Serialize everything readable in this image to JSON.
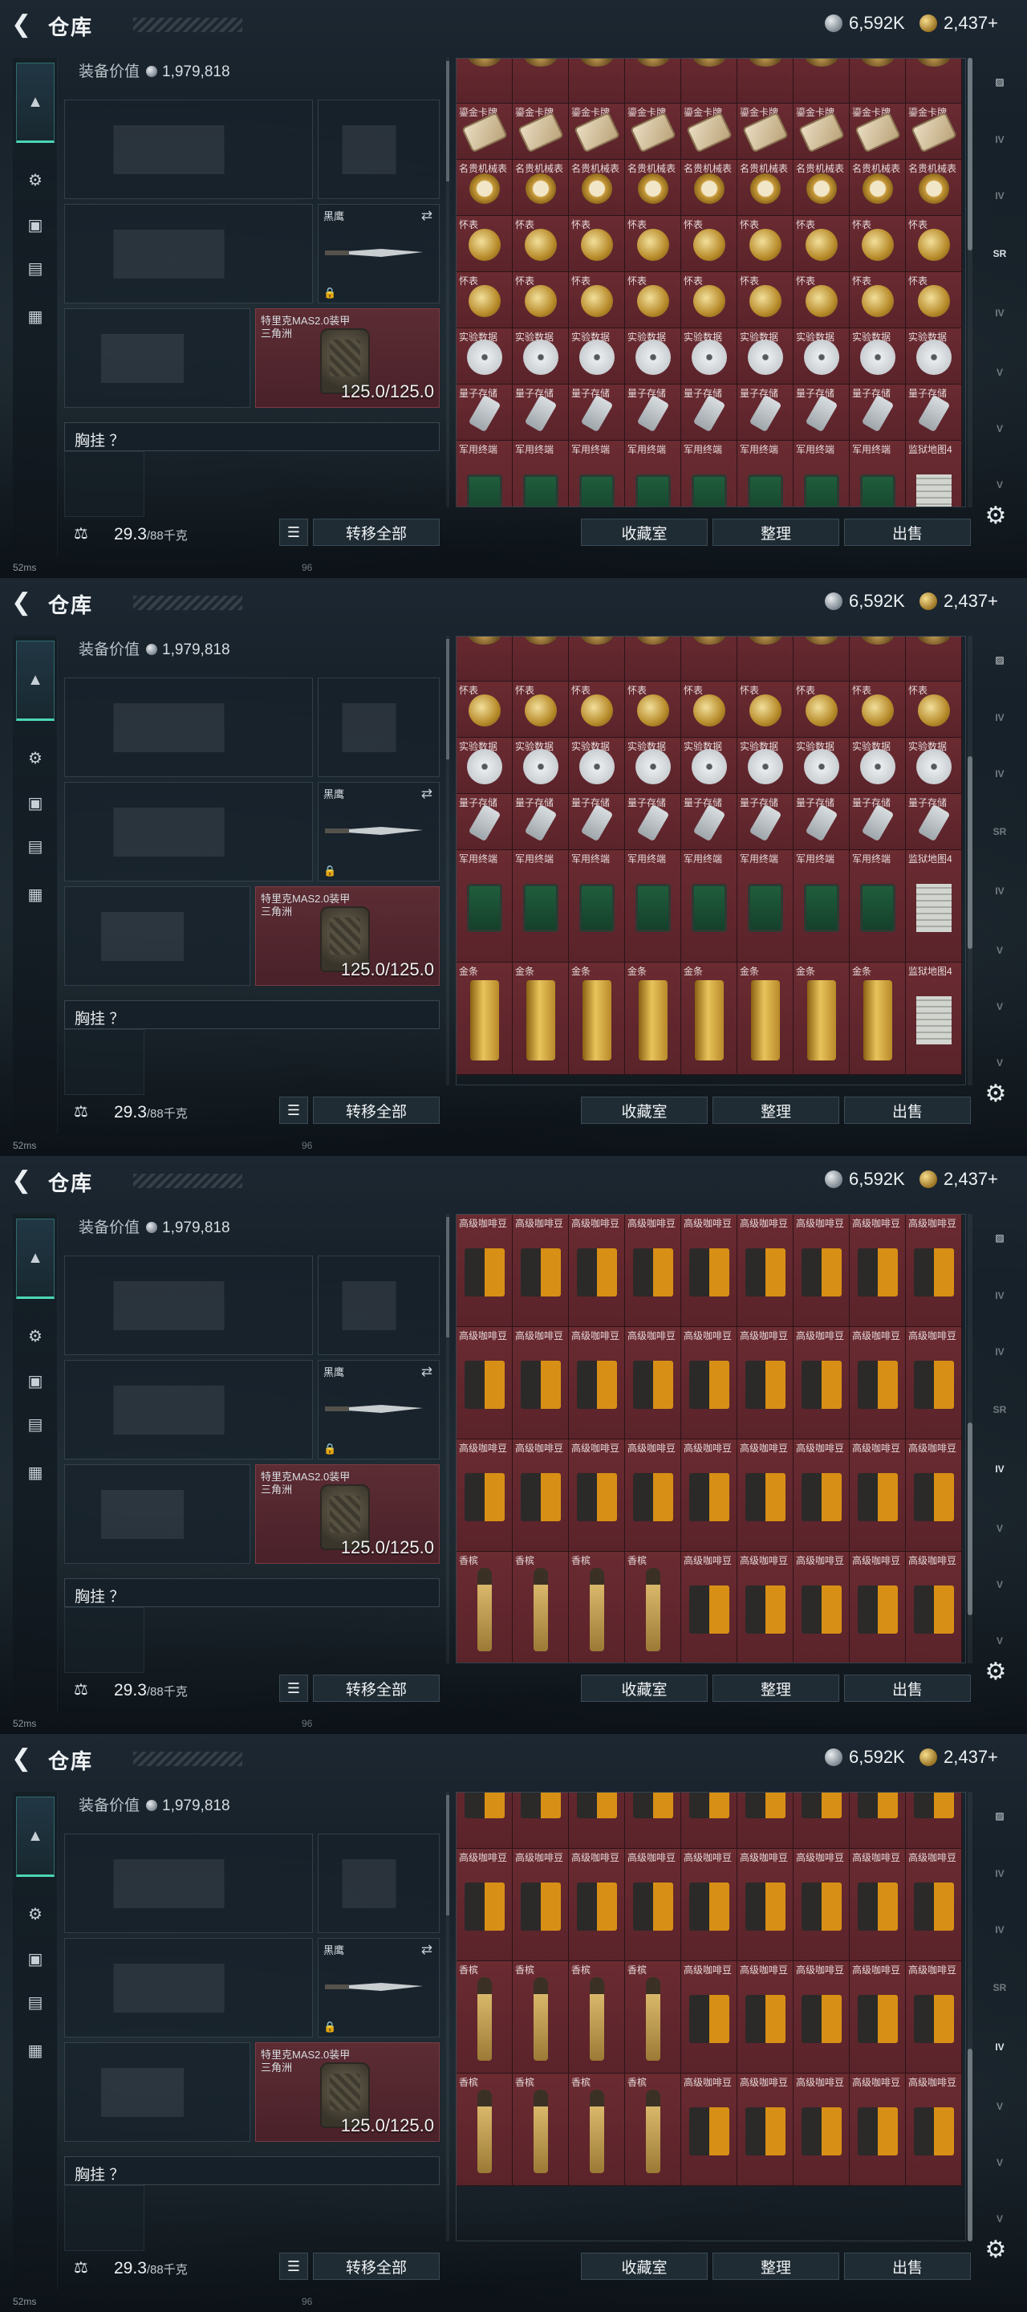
{
  "header": {
    "title": "仓库",
    "currency_silver": "6,592K",
    "currency_gold": "2,437+"
  },
  "loadout": {
    "value_label": "装备价值",
    "value": "1,979,818",
    "melee_name": "黑鹰",
    "armor_name": "特里克MAS2.0装甲",
    "armor_source": "三角洲",
    "armor_durability": "125.0/125.0",
    "chest_label": "胸挂 ？",
    "weight": "29.3",
    "weight_cap": "/88千克"
  },
  "buttons": {
    "transfer_all": "转移全部",
    "collection": "收藏室",
    "sort": "整理",
    "sell": "出售"
  },
  "status": {
    "ping": "52ms",
    "fps": "96"
  },
  "items": {
    "card": "鎏金卡牌",
    "watch": "名贵机械表",
    "pocket": "怀表",
    "data": "实验数据",
    "usb": "量子存储",
    "terminal": "军用终端",
    "map": "监狱地图4",
    "gold": "金条",
    "coffee": "高级咖啡豆",
    "champagne": "香槟"
  },
  "right_rail": [
    "vault-icon",
    "rack-1",
    "rack-2",
    "rack-3",
    "rack-4",
    "rack-5"
  ]
}
